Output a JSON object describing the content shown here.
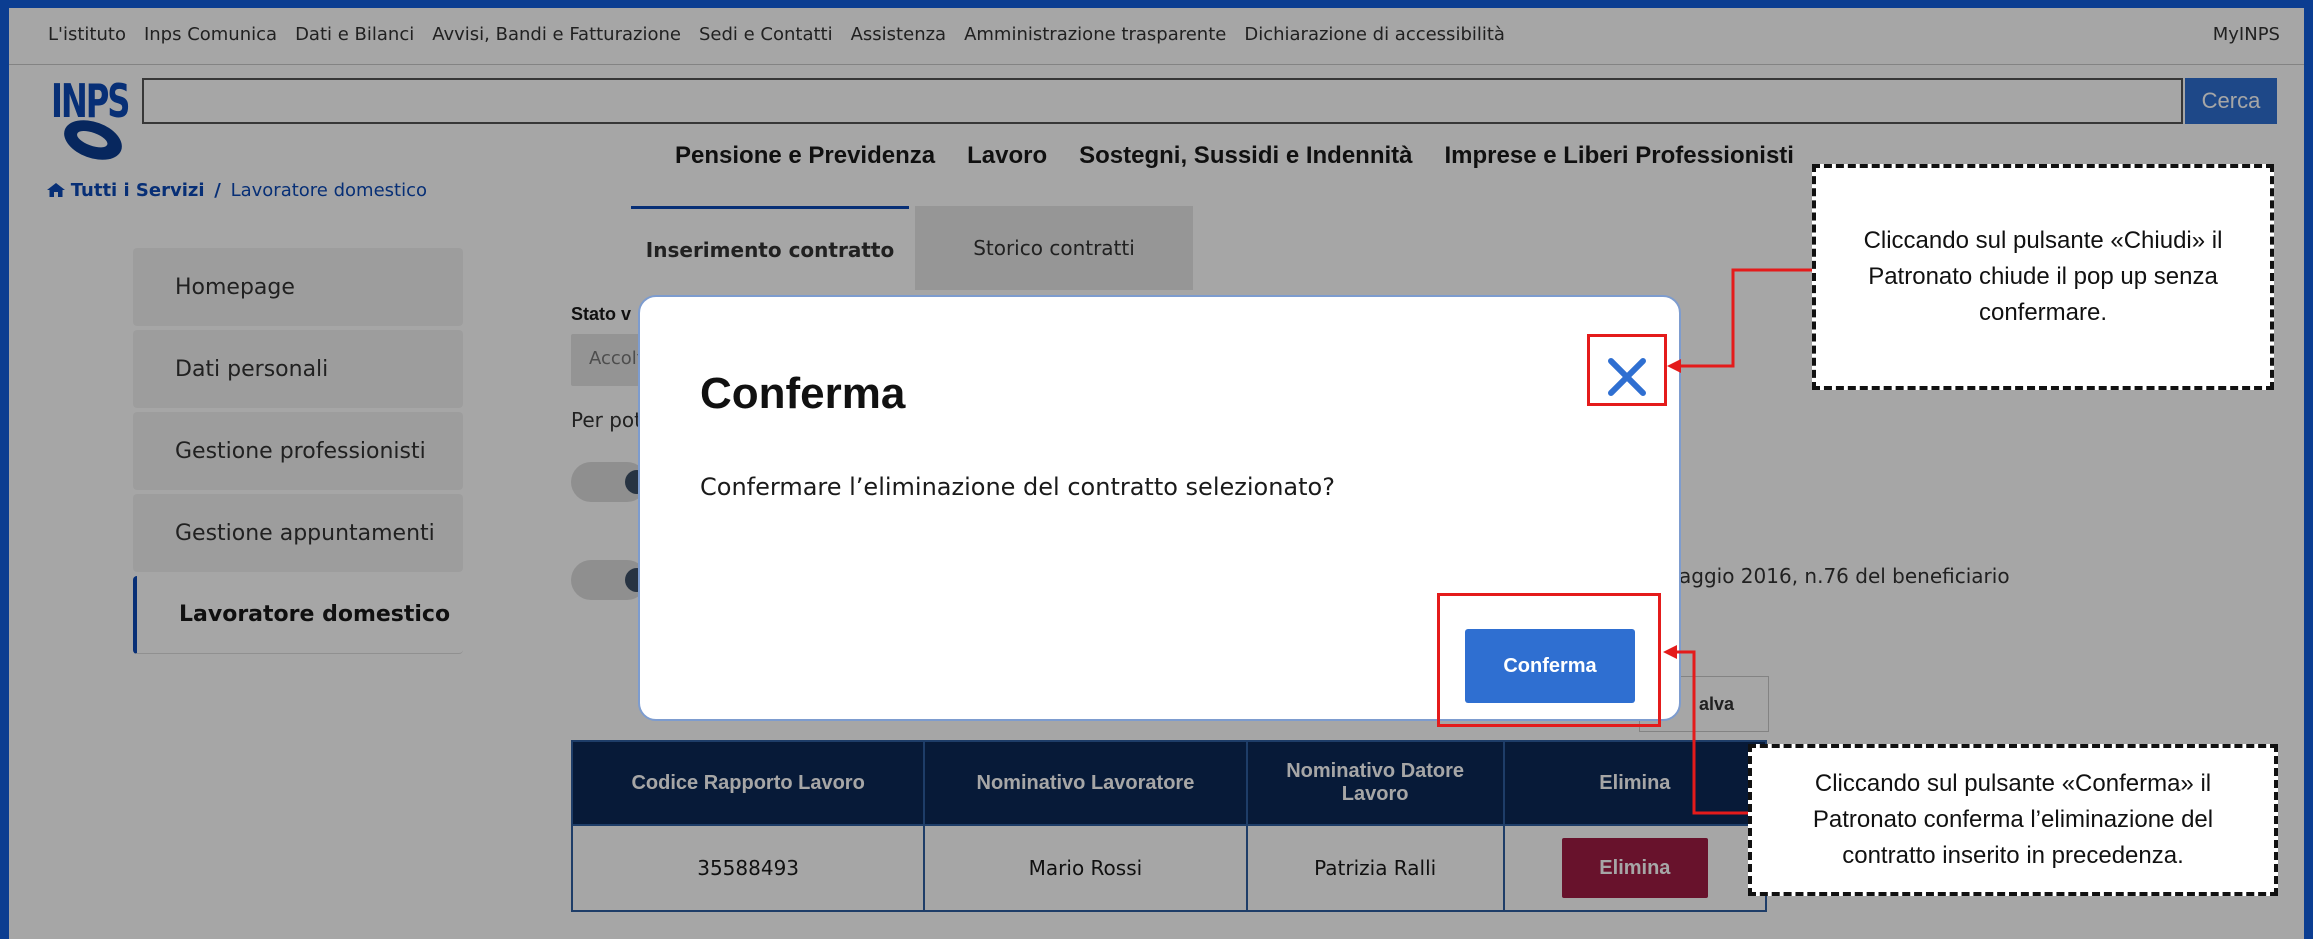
{
  "topnav": {
    "links": [
      "L'istituto",
      "Inps Comunica",
      "Dati e Bilanci",
      "Avvisi, Bandi e Fatturazione",
      "Sedi e Contatti",
      "Assistenza",
      "Amministrazione trasparente",
      "Dichiarazione di accessibilità"
    ],
    "myinps": "MyINPS"
  },
  "logo": {
    "text": "INPS"
  },
  "search": {
    "button_label": "Cerca",
    "value": ""
  },
  "mainnav": [
    "Pensione e Previdenza",
    "Lavoro",
    "Sostegni, Sussidi e Indennità",
    "Imprese e Liberi Professionisti"
  ],
  "breadcrumb": {
    "home": "Tutti i Servizi",
    "separator": "/",
    "current": "Lavoratore domestico"
  },
  "sidebar": {
    "items": [
      {
        "label": "Homepage"
      },
      {
        "label": "Dati personali"
      },
      {
        "label": "Gestione professionisti"
      },
      {
        "label": "Gestione appuntamenti"
      },
      {
        "label": "Lavoratore domestico",
        "active": true
      }
    ]
  },
  "tabs": [
    {
      "label": "Inserimento contratto",
      "active": true
    },
    {
      "label": "Storico contratti",
      "active": false
    }
  ],
  "form": {
    "status_label": "Stato v",
    "status_value": "Accolt",
    "helper_text": "Per pot",
    "law_text": "aggio 2016, n.76 del beneficiario",
    "save_label": "alva"
  },
  "table": {
    "headers": [
      "Codice Rapporto Lavoro",
      "Nominativo Lavoratore",
      "Nominativo Datore Lavoro",
      "Elimina"
    ],
    "rows": [
      {
        "codice": "35588493",
        "lavoratore": "Mario Rossi",
        "datore": "Patrizia Ralli",
        "action": "Elimina"
      }
    ]
  },
  "modal": {
    "title": "Conferma",
    "message": "Confermare l’eliminazione del contratto selezionato?",
    "confirm_label": "Conferma"
  },
  "callouts": {
    "close": "Cliccando sul pulsante «Chiudi» il Patronato chiude il pop up senza confermare.",
    "confirm": "Cliccando sul pulsante «Conferma» il Patronato conferma l’eliminazione del contratto inserito in precedenza."
  },
  "colors": {
    "brand_blue": "#0b49b5",
    "primary_button": "#2f6fd1",
    "table_header": "#0c2856",
    "delete_button": "#a01c44",
    "annotation_red": "#e41b1b"
  },
  "icons": {
    "home": "home-icon",
    "close": "close-icon"
  }
}
